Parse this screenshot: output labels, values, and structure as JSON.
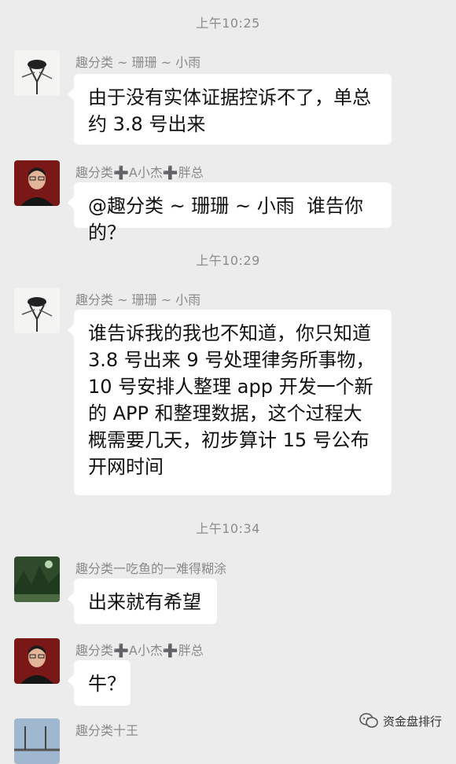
{
  "messages": [
    {
      "type": "time",
      "text": "上午10:25"
    },
    {
      "type": "msg",
      "sender": "趣分类 ~ 珊珊 ~ 小雨",
      "text": "由于没有实体证据控诉不了，单总约 3.8 号出来"
    },
    {
      "type": "msg",
      "sender": "趣分类➕A小杰➕胖总",
      "text": "@趣分类 ~ 珊珊 ~ 小雨  谁告你的？"
    },
    {
      "type": "time",
      "text": "上午10:29"
    },
    {
      "type": "msg",
      "sender": "趣分类 ~ 珊珊 ~ 小雨",
      "text": "谁告诉我的我也不知道，你只知道 3.8 号出来 9 号处理律务所事物，10 号安排人整理 app 开发一个新的 APP 和整理数据，这个过程大概需要几天，初步算计 15 号公布开网时间"
    },
    {
      "type": "time",
      "text": "上午10:34"
    },
    {
      "type": "msg",
      "sender": "趣分类一吃鱼的一难得糊涂",
      "text": "出来就有希望"
    },
    {
      "type": "msg",
      "sender": "趣分类➕A小杰➕胖总",
      "text": "牛？"
    },
    {
      "type": "msg",
      "sender": "趣分类十王",
      "text": ""
    }
  ],
  "watermark": {
    "text": "资金盘排行",
    "icon": "wechat-official-account-icon"
  },
  "colors": {
    "background": "#ececec",
    "bubble": "#ffffff",
    "meta_text": "#8c8c8c"
  }
}
